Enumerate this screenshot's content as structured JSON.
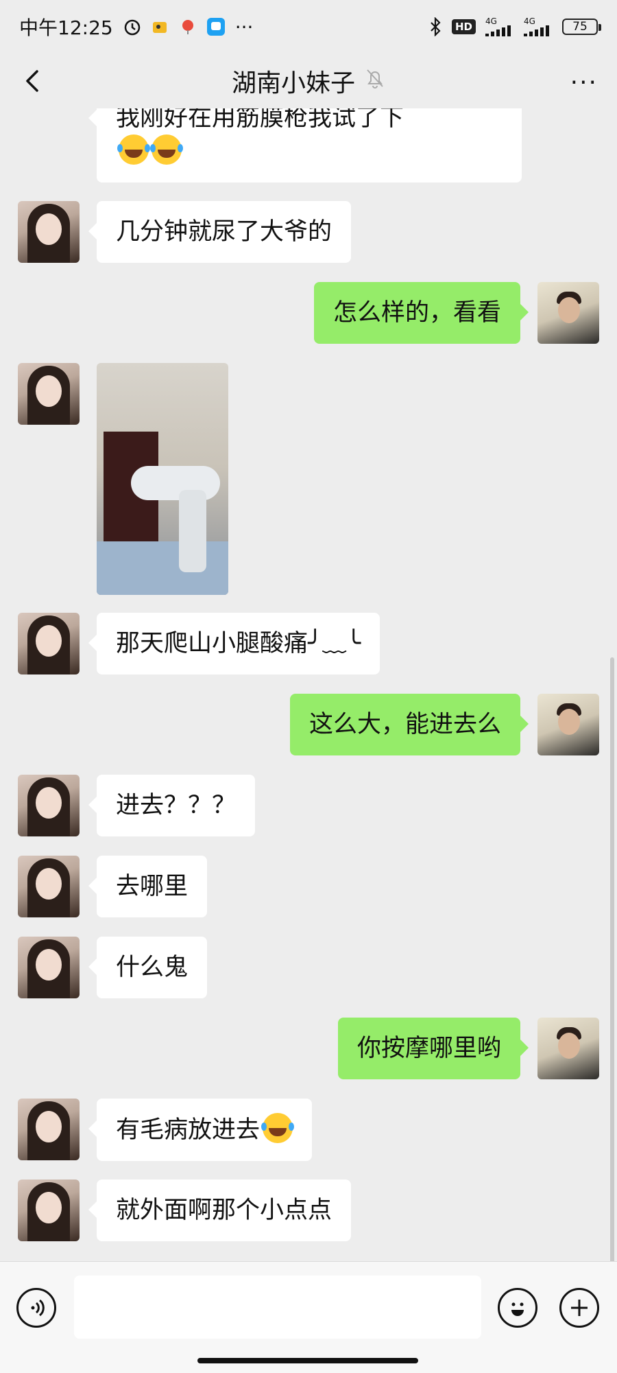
{
  "status_bar": {
    "time": "中午12:25",
    "more": "···",
    "hd": "HD",
    "net1": "4G",
    "net2": "4G",
    "battery": "75"
  },
  "header": {
    "title": "湖南小妹子",
    "more": "···"
  },
  "messages": [
    {
      "side": "left",
      "text": "我刚好在用筋膜枪我试了下",
      "emoji_count": 2
    },
    {
      "side": "left",
      "text": "几分钟就尿了大爷的"
    },
    {
      "side": "right",
      "text": "怎么样的，看看"
    },
    {
      "side": "left",
      "type": "image"
    },
    {
      "side": "left",
      "text": "那天爬山小腿酸痛╯﹏╰"
    },
    {
      "side": "right",
      "text": "这么大，能进去么"
    },
    {
      "side": "left",
      "text": "进去？？？"
    },
    {
      "side": "left",
      "text": "去哪里"
    },
    {
      "side": "left",
      "text": "什么鬼"
    },
    {
      "side": "right",
      "text": "你按摩哪里哟"
    },
    {
      "side": "left",
      "text": "有毛病放进去",
      "emoji_count": 1
    },
    {
      "side": "left",
      "text": "就外面啊那个小点点"
    }
  ],
  "input_bar": {
    "voice_icon": "voice-icon",
    "emoji_icon": "emoji-icon",
    "plus_icon": "plus-icon"
  }
}
